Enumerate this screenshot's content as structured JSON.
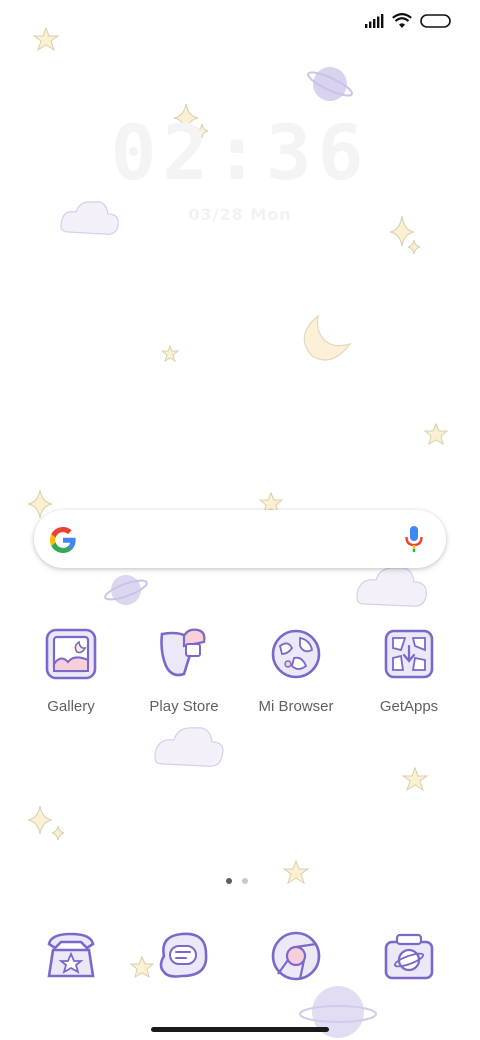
{
  "status_bar": {
    "signal_icon": "signal-bars-icon",
    "wifi_icon": "wifi-icon",
    "battery_icon": "battery-icon"
  },
  "lockclock": {
    "time": "02:36",
    "date": "03/28 Mon"
  },
  "search": {
    "logo_icon": "google-g-icon",
    "mic_icon": "microphone-icon"
  },
  "apps": [
    {
      "label": "Gallery",
      "icon": "gallery-icon"
    },
    {
      "label": "Play Store",
      "icon": "play-store-icon"
    },
    {
      "label": "Mi Browser",
      "icon": "browser-globe-icon"
    },
    {
      "label": "GetApps",
      "icon": "getapps-icon"
    }
  ],
  "page_indicator": {
    "pages": 2,
    "current": 1
  },
  "dock": [
    {
      "icon": "phone-icon"
    },
    {
      "icon": "messages-icon"
    },
    {
      "icon": "chrome-icon"
    },
    {
      "icon": "camera-icon"
    }
  ],
  "colors": {
    "icon_stroke": "#7b68c8",
    "icon_fill": "#e8e3f7",
    "accent_pink": "#f7cfd9",
    "label": "#5f5f6a",
    "star": "#fbf1d2",
    "cloud": "#f3eff9"
  }
}
